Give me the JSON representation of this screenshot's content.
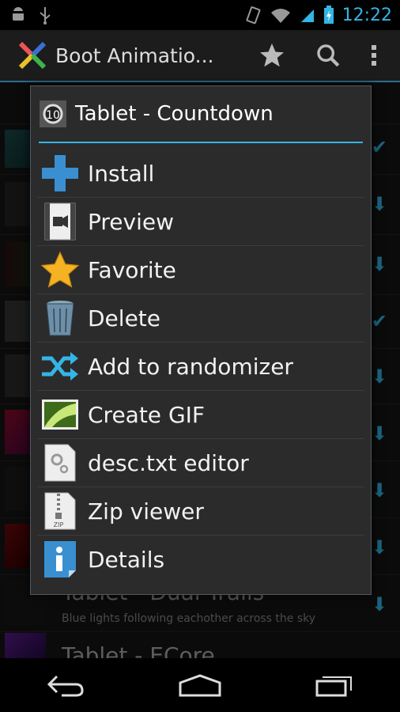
{
  "status_bar": {
    "time": "12:22",
    "icons": [
      "android-icon",
      "usb-icon",
      "vibrate-icon",
      "wifi-icon",
      "signal-icon",
      "battery-charging-icon"
    ]
  },
  "action_bar": {
    "title": "Boot Animatio...",
    "icons": [
      "app-logo-icon",
      "star-icon",
      "search-icon",
      "overflow-menu-icon"
    ]
  },
  "background_list": {
    "visible_rows": [
      {
        "title": "Tablet - Dual Trails",
        "description": "Blue lights following eachother across the sky"
      },
      {
        "title": "Tablet - ECore"
      }
    ]
  },
  "dialog": {
    "title": "Tablet - Countdown",
    "items": [
      {
        "label": "Install",
        "icon": "plus-icon"
      },
      {
        "label": "Preview",
        "icon": "video-icon"
      },
      {
        "label": "Favorite",
        "icon": "star-icon"
      },
      {
        "label": "Delete",
        "icon": "trash-icon"
      },
      {
        "label": "Add to randomizer",
        "icon": "shuffle-icon"
      },
      {
        "label": "Create GIF",
        "icon": "image-icon"
      },
      {
        "label": "desc.txt editor",
        "icon": "settings-file-icon"
      },
      {
        "label": "Zip viewer",
        "icon": "zip-file-icon"
      },
      {
        "label": "Details",
        "icon": "info-icon"
      }
    ]
  },
  "colors": {
    "accent": "#33b5e5",
    "dialog_bg": "#2b2b2b",
    "bar_bg": "#1c1c1c"
  }
}
